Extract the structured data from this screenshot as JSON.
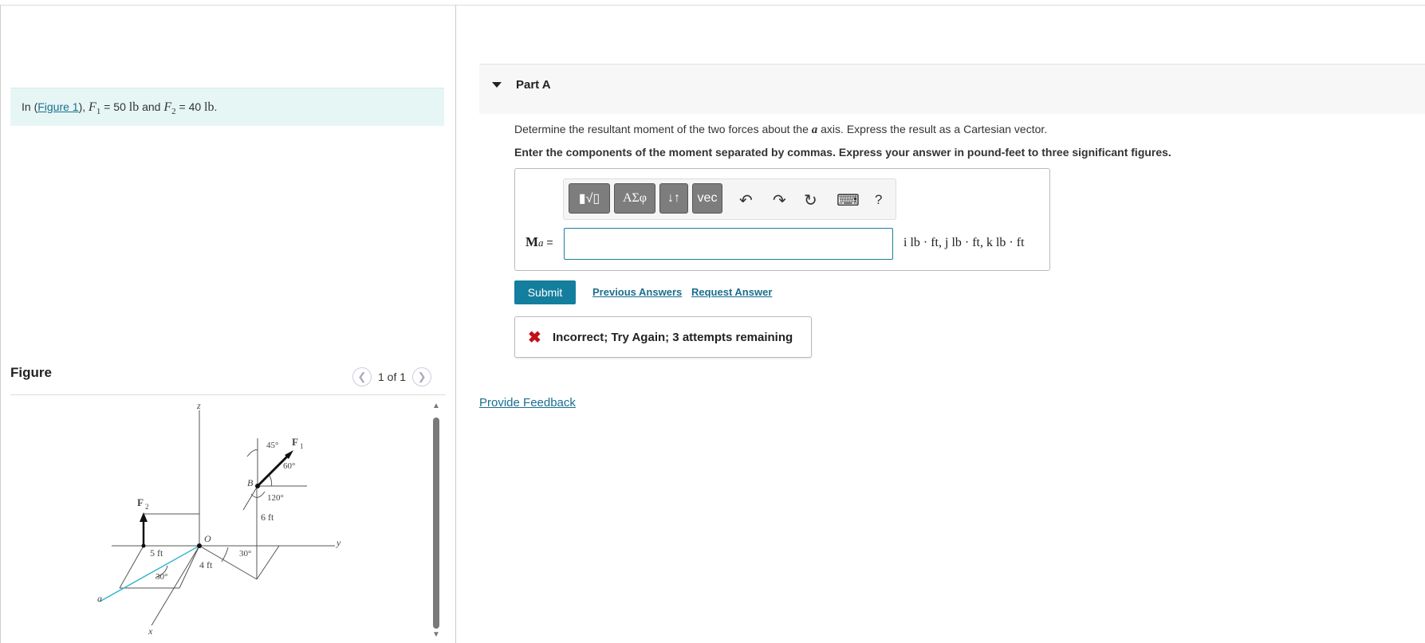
{
  "intro": {
    "prefix": "In (",
    "link": "Figure 1",
    "suffix": "), ",
    "f1_symbol": "F",
    "f1_sub": "1",
    "f1_eq": " = 50 ",
    "unit": "lb",
    "mid": " and ",
    "f2_symbol": "F",
    "f2_sub": "2",
    "f2_eq": " = 40 ",
    "end": "."
  },
  "figure": {
    "title": "Figure",
    "pager": "1 of 1",
    "labels": {
      "z": "z",
      "y": "y",
      "x": "x",
      "a": "a",
      "F1": "F",
      "F1_sub": "1",
      "F2": "F",
      "F2_sub": "2",
      "B": "B",
      "O": "O",
      "ang45": "45°",
      "ang60": "60°",
      "ang120": "120°",
      "ang30a": "30°",
      "ang30b": "30°",
      "d6": "6 ft",
      "d5": "5 ft",
      "d4": "4 ft"
    }
  },
  "part": {
    "title": "Part A"
  },
  "question": {
    "line1_pre": "Determine the resultant moment of the two forces about the ",
    "line1_var": "a",
    "line1_post": " axis. Express the result as a Cartesian vector.",
    "line2": "Enter the components of the moment separated by commas. Express your answer in pound-feet to three significant figures."
  },
  "toolbar": {
    "templates": "▮√▯",
    "greek": "ΑΣφ",
    "arrows": "↓↑",
    "vec": "vec",
    "undo": "↶",
    "redo": "↷",
    "reset": "↻",
    "keyboard": "⌨",
    "help": "?"
  },
  "answer": {
    "label_bold": "M",
    "label_sub": "a",
    "label_eq": " =",
    "value": "",
    "units": "i lb · ft, j lb · ft, k lb · ft"
  },
  "actions": {
    "submit": "Submit",
    "previous": "Previous Answers",
    "request": "Request Answer"
  },
  "feedback": {
    "icon": "✖",
    "message": "Incorrect; Try Again; 3 attempts remaining"
  },
  "provide_feedback": "Provide Feedback"
}
